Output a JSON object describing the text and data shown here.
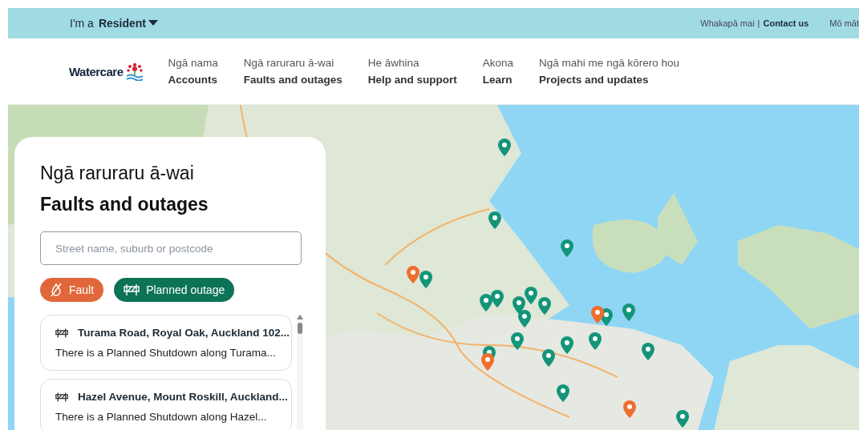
{
  "top_bar": {
    "audience_prefix": "I'm a",
    "audience": "Resident",
    "contact_label": "Whakapā mai",
    "separator": "|",
    "contact_link": "Contact us",
    "language_link": "Mō māt"
  },
  "header": {
    "logo": "Watercare",
    "nav": [
      {
        "maori": "Ngā nama",
        "english": "Accounts"
      },
      {
        "maori": "Ngā raruraru ā-wai",
        "english": "Faults and outages"
      },
      {
        "maori": "He āwhina",
        "english": "Help and support"
      },
      {
        "maori": "Akona",
        "english": "Learn"
      },
      {
        "maori": "Ngā mahi me ngā kōrero hou",
        "english": "Projects and updates"
      }
    ]
  },
  "panel": {
    "title_maori": "Ngā raruraru ā-wai",
    "title_english": "Faults and outages",
    "search": {
      "placeholder": "Street name, suburb or postcode"
    },
    "filters": [
      {
        "kind": "fault",
        "label": "Fault",
        "color": "#e0673a"
      },
      {
        "kind": "planned",
        "label": "Planned outage",
        "color": "#0d7356"
      }
    ],
    "results": [
      {
        "kind": "planned",
        "title": "Turama Road, Royal Oak, Auckland 102...",
        "summary": "There is a Planned Shutdown along Turama..."
      },
      {
        "kind": "planned",
        "title": "Hazel Avenue, Mount Roskill, Auckland...",
        "summary": "There is a Planned Shutdown along Hazel..."
      }
    ]
  }
}
